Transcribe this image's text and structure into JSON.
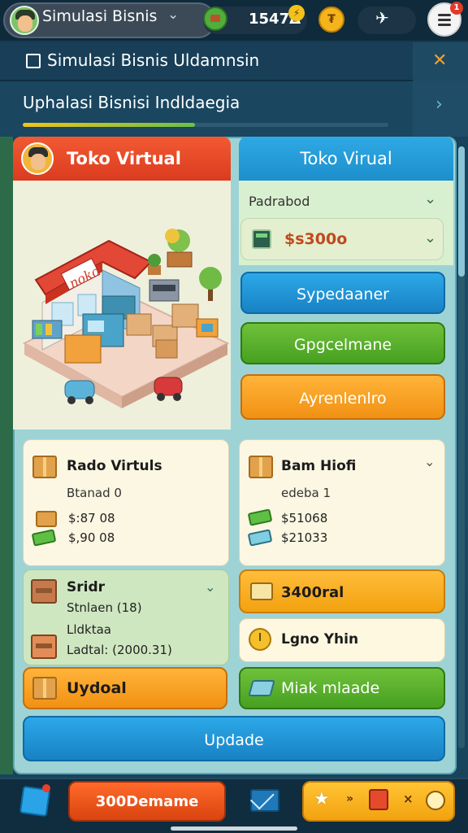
{
  "hud": {
    "title": "Simulasi Bisnis",
    "coins": "1547Δ",
    "menu_badge": "1",
    "gold_symbol": "₮"
  },
  "panel": {
    "title": "Simulasi Bisnis Uldamnsin",
    "subtitle": "Uphalasi Bisnisi Indldaegia",
    "progress": 0.47
  },
  "store_card": {
    "title": "Toko Virtual",
    "sign_text": "noko"
  },
  "right_card": {
    "title": "Toko Virual",
    "dropdown_label": "Padrabod",
    "dropdown_value": "$s300o",
    "buttons": [
      "Sypedaaner",
      "Gpgcelmane",
      "Ayrenlenlro"
    ]
  },
  "rado_card": {
    "title": "Rado Virtuls",
    "subtitle": "Btanad 0",
    "values": [
      "$:87 08",
      "$,90 08"
    ]
  },
  "stock_card": {
    "title": "Sridr",
    "lines": [
      "Stnlaen (18)",
      "Lldktaa",
      "Ladtal: (2000.31)"
    ]
  },
  "upload_button": "Uydoal",
  "bam_card": {
    "title": "Bam Hiofi",
    "subtitle": "edeba 1",
    "values": [
      "$51068",
      "$21033"
    ]
  },
  "ticket_button": "3400ral",
  "logo_button": "Lgno Yhin",
  "market_button": "Miak mlaade",
  "update_button": "Updade",
  "bottom_bar": {
    "main_button": "300Demame",
    "arrows": "»",
    "x": "×"
  },
  "colors": {
    "accent_orange": "#f19113",
    "accent_blue": "#1c8fcd",
    "accent_green": "#47a021",
    "accent_red": "#db3b1f"
  }
}
